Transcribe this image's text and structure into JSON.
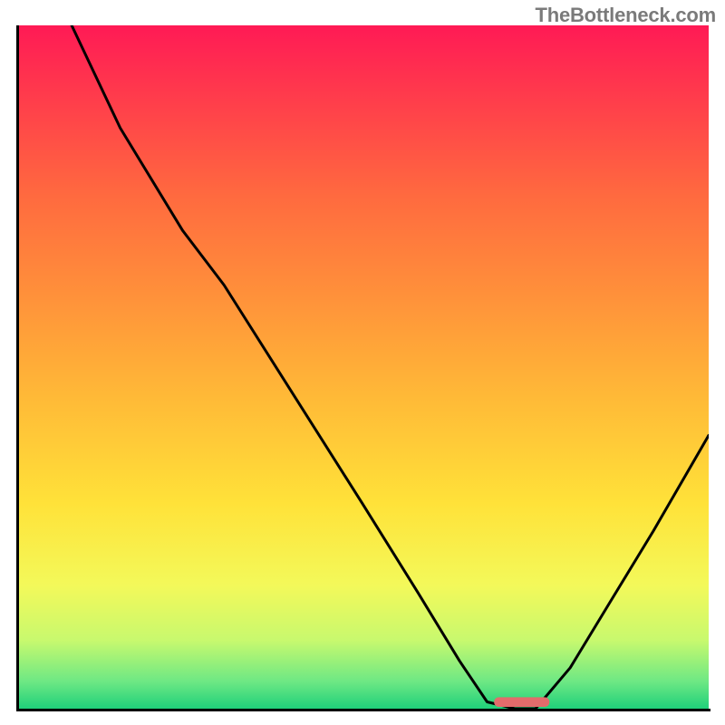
{
  "watermark": "TheBottleneck.com",
  "chart_data": {
    "type": "line",
    "title": "",
    "xlabel": "",
    "ylabel": "",
    "x_range": [
      0,
      100
    ],
    "y_range": [
      0,
      100
    ],
    "note": "Axes have no tick labels in the image; x and y are normalized 0–100. y=0 is optimal (green band), y=100 is worst (red). Curve shape estimated from pixels.",
    "series": [
      {
        "name": "bottleneck-curve",
        "color": "#000000",
        "x": [
          8,
          15,
          24,
          30,
          40,
          50,
          58,
          64,
          68,
          72,
          75,
          80,
          86,
          92,
          100
        ],
        "y": [
          100,
          85,
          70,
          62,
          46,
          30,
          17,
          7,
          1,
          0,
          0,
          6,
          16,
          26,
          40
        ]
      }
    ],
    "background_gradient": {
      "stops": [
        {
          "offset": 0.0,
          "color": "#ff1a55"
        },
        {
          "offset": 0.1,
          "color": "#ff3a4c"
        },
        {
          "offset": 0.25,
          "color": "#ff6a3f"
        },
        {
          "offset": 0.4,
          "color": "#ff923a"
        },
        {
          "offset": 0.55,
          "color": "#ffbb37"
        },
        {
          "offset": 0.7,
          "color": "#ffe239"
        },
        {
          "offset": 0.82,
          "color": "#f3f95a"
        },
        {
          "offset": 0.9,
          "color": "#c8f96e"
        },
        {
          "offset": 0.96,
          "color": "#6ee884"
        },
        {
          "offset": 1.0,
          "color": "#1fd07a"
        }
      ]
    },
    "marker": {
      "name": "optimal-zone-marker",
      "x": 73,
      "y": 0,
      "width_pct": 8,
      "height_pct": 1.4,
      "color": "#e36b6b"
    }
  },
  "colors": {
    "frame_black": "#000000",
    "watermark_gray": "#7a7a7a",
    "marker_pink": "#e36b6b"
  }
}
